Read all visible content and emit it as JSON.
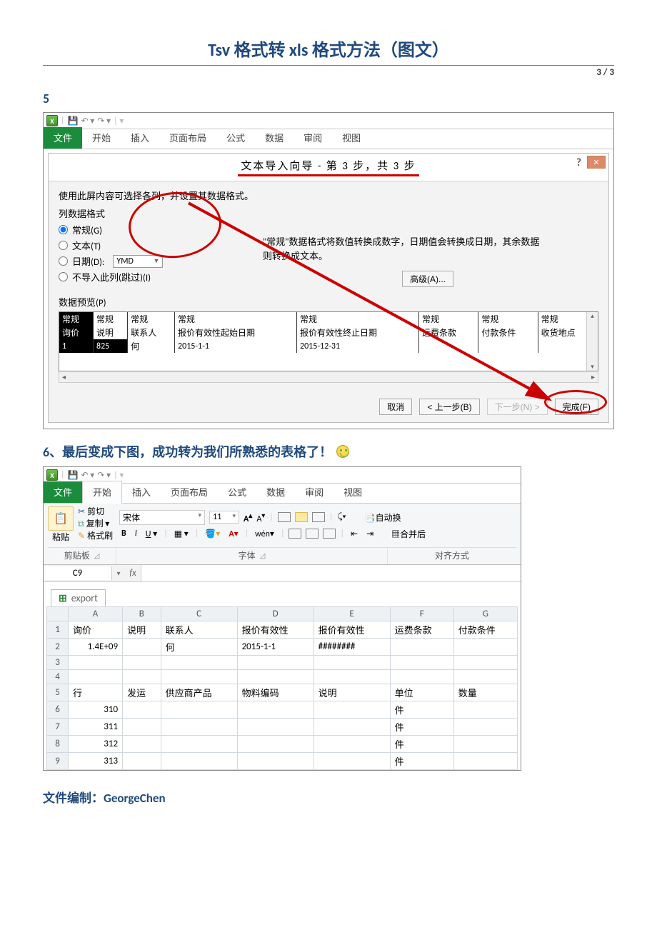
{
  "doc": {
    "title": "Tsv 格式转 xls 格式方法（图文）",
    "page": "3 / 3",
    "step5": "5",
    "step6": "6、最后变成下图，成功转为我们所熟悉的表格了！",
    "author_label": "文件编制：",
    "author_name": "GeorgeChen"
  },
  "ribbon_tabs": [
    "文件",
    "开始",
    "插入",
    "页面布局",
    "公式",
    "数据",
    "审阅",
    "视图"
  ],
  "dialog": {
    "title": "文本导入向导 - 第 3 步，共 3 步",
    "help": "?",
    "close": "✕",
    "instruction": "使用此屏内容可选择各列，并设置其数据格式。",
    "col_format_label": "列数据格式",
    "radios": {
      "general": "常规(G)",
      "text": "文本(T)",
      "date": "日期(D):",
      "date_fmt": "YMD",
      "skip": "不导入此列(跳过)(I)"
    },
    "desc": "\"常规\"数据格式将数值转换成数字，日期值会转换成日期，其余数据则转换成文本。",
    "advanced": "高级(A)...",
    "preview_label": "数据预览(P)",
    "preview_headers": [
      "常规",
      "常规",
      "常规",
      "常规",
      "常规",
      "常规",
      "常规",
      "常规"
    ],
    "preview_row1": [
      "询价",
      "说明",
      "联系人",
      "报价有效性起始日期",
      "报价有效性终止日期",
      "运费条款",
      "付款条件",
      "收货地点"
    ],
    "preview_row2": [
      "1",
      "825",
      "何",
      "2015-1-1",
      "2015-12-31",
      "",
      "",
      ""
    ],
    "buttons": {
      "cancel": "取消",
      "back": "< 上一步(B)",
      "next": "下一步(N) >",
      "finish": "完成(F)"
    }
  },
  "excel2": {
    "paste_label": "粘贴",
    "clip": {
      "cut": "剪切",
      "copy": "复制 ▾",
      "format": "格式刷"
    },
    "groups": {
      "clipboard": "剪贴板",
      "font": "字体",
      "align": "对齐方式"
    },
    "font_name": "宋体",
    "font_size": "11",
    "autowrap": "自动换",
    "merge": "合并后",
    "cell_ref": "C9",
    "book_tab": "export",
    "col_letters": [
      "A",
      "B",
      "C",
      "D",
      "E",
      "F",
      "G"
    ],
    "rows": [
      {
        "n": "1",
        "cells": [
          "询价",
          "说明",
          "联系人",
          "报价有效性",
          "报价有效性",
          "运费条款",
          "付款条件"
        ]
      },
      {
        "n": "2",
        "cells": [
          "1.4E+09",
          "",
          "何",
          "2015-1-1",
          "########",
          "",
          ""
        ]
      },
      {
        "n": "3",
        "cells": [
          "",
          "",
          "",
          "",
          "",
          "",
          ""
        ]
      },
      {
        "n": "4",
        "cells": [
          "",
          "",
          "",
          "",
          "",
          "",
          ""
        ]
      },
      {
        "n": "5",
        "cells": [
          "行",
          "发运",
          "供应商产品",
          "物料编码",
          "说明",
          "单位",
          "数量"
        ]
      },
      {
        "n": "6",
        "cells": [
          "310",
          "",
          "",
          "",
          "",
          "件",
          ""
        ]
      },
      {
        "n": "7",
        "cells": [
          "311",
          "",
          "",
          "",
          "",
          "件",
          ""
        ]
      },
      {
        "n": "8",
        "cells": [
          "312",
          "",
          "",
          "",
          "",
          "件",
          ""
        ]
      },
      {
        "n": "9",
        "cells": [
          "313",
          "",
          "",
          "",
          "",
          "件",
          ""
        ]
      }
    ]
  }
}
